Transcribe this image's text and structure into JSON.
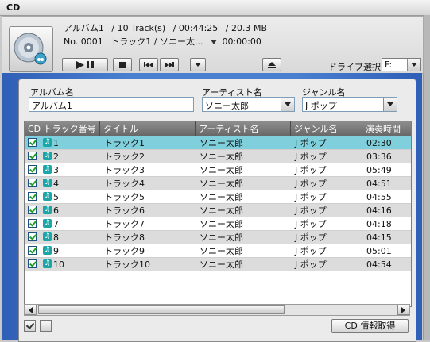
{
  "window": {
    "title": "CD"
  },
  "album_info": {
    "album": "アルバム1",
    "track_count": "/ 10 Track(s)",
    "total_time": "/ 00:44:25",
    "size": "/ 20.3 MB",
    "number": "No. 0001",
    "now_track": "トラック1 / ソニー太...",
    "elapsed": "00:00:00"
  },
  "controls": {
    "play_pause": "play-pause",
    "stop": "stop",
    "prev": "previous",
    "next": "next",
    "menu": "menu",
    "eject": "eject"
  },
  "drive": {
    "label": "ドライブ選択",
    "value": "F:"
  },
  "fields": {
    "album_label": "アルバム名",
    "album_value": "アルバム1",
    "artist_label": "アーティスト名",
    "artist_value": "ソニー太郎",
    "genre_label": "ジャンル名",
    "genre_value": "J ポップ"
  },
  "table": {
    "columns": [
      "CD トラック番号",
      "タイトル",
      "アーティスト名",
      "ジャンル名",
      "演奏時間"
    ],
    "rows": [
      {
        "num": "1",
        "title": "トラック1",
        "artist": "ソニー太郎",
        "genre": "J ポップ",
        "time": "02:30"
      },
      {
        "num": "2",
        "title": "トラック2",
        "artist": "ソニー太郎",
        "genre": "J ポップ",
        "time": "03:36"
      },
      {
        "num": "3",
        "title": "トラック3",
        "artist": "ソニー太郎",
        "genre": "J ポップ",
        "time": "05:49"
      },
      {
        "num": "4",
        "title": "トラック4",
        "artist": "ソニー太郎",
        "genre": "J ポップ",
        "time": "04:51"
      },
      {
        "num": "5",
        "title": "トラック5",
        "artist": "ソニー太郎",
        "genre": "J ポップ",
        "time": "04:55"
      },
      {
        "num": "6",
        "title": "トラック6",
        "artist": "ソニー太郎",
        "genre": "J ポップ",
        "time": "04:16"
      },
      {
        "num": "7",
        "title": "トラック7",
        "artist": "ソニー太郎",
        "genre": "J ポップ",
        "time": "04:18"
      },
      {
        "num": "8",
        "title": "トラック8",
        "artist": "ソニー太郎",
        "genre": "J ポップ",
        "time": "04:15"
      },
      {
        "num": "9",
        "title": "トラック9",
        "artist": "ソニー太郎",
        "genre": "J ポップ",
        "time": "05:01"
      },
      {
        "num": "10",
        "title": "トラック10",
        "artist": "ソニー太郎",
        "genre": "J ポップ",
        "time": "04:54"
      }
    ]
  },
  "footer": {
    "info_button": "CD 情報取得"
  },
  "colors": {
    "selected_row": "#7fd0dc",
    "stripe_row": "#dcdcdc",
    "background_blue": "#3a6cc4"
  }
}
